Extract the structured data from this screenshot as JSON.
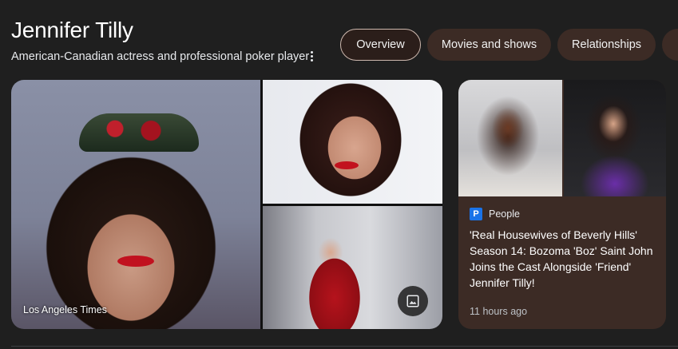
{
  "entity": {
    "name": "Jennifer Tilly",
    "description": "American-Canadian actress and professional poker player"
  },
  "tabs": [
    {
      "label": "Overview",
      "active": true
    },
    {
      "label": "Movies and shows",
      "active": false
    },
    {
      "label": "Relationships",
      "active": false
    }
  ],
  "images": {
    "main_caption": "Los Angeles Times"
  },
  "news": {
    "source": "People",
    "source_logo_letter": "P",
    "headline": "'Real Housewives of Beverly Hills' Season 14: Bozoma 'Boz' Saint John Joins the Cast Alongside 'Friend' Jennifer Tilly!",
    "time": "11 hours ago"
  },
  "colors": {
    "background": "#1f1f1f",
    "chip": "#3c2b25",
    "chip_active_border": "#cdb8ae",
    "source_blue": "#1a73e8"
  }
}
